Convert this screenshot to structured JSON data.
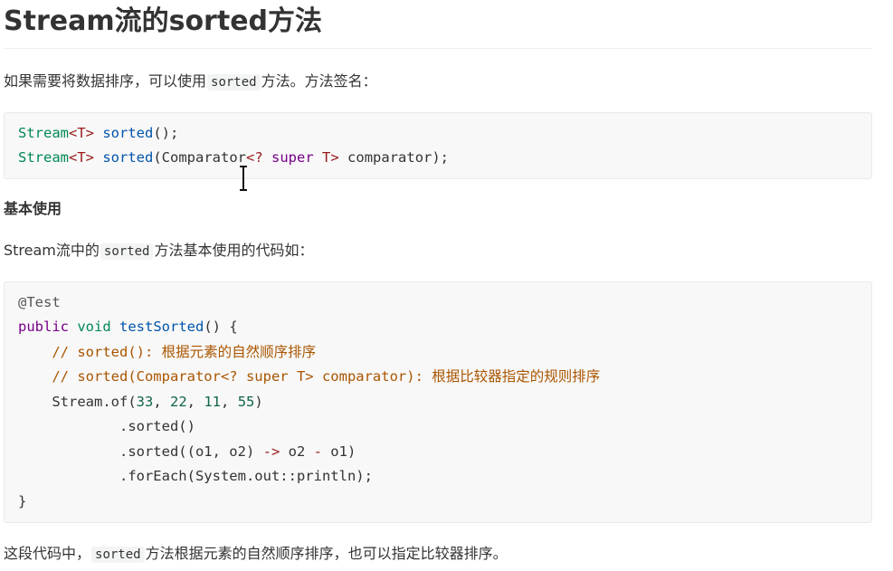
{
  "page": {
    "title": "Stream流的sorted方法",
    "intro": {
      "before": "如果需要将数据排序，可以使用",
      "code": "sorted",
      "after": "方法。方法签名："
    },
    "signatures": [
      [
        "Stream",
        "<T>",
        " ",
        "sorted",
        "();"
      ],
      [
        "Stream",
        "<T>",
        " ",
        "sorted",
        "(Comparator",
        "<?",
        " ",
        "super",
        " ",
        "T>",
        " comparator);"
      ]
    ],
    "subheading": "基本使用",
    "usage_intro": {
      "before": "Stream流中的",
      "code": "sorted",
      "after": "方法基本使用的代码如："
    },
    "example": {
      "annotation": "@Test",
      "kw_public": "public",
      "kw_void": "void",
      "method_name": "testSorted",
      "method_tail": "() {",
      "comment1": "// sorted(): 根据元素的自然顺序排序",
      "comment2": "// sorted(Comparator<? super T> comparator): 根据比较器指定的规则排序",
      "stream_of": "Stream.of(",
      "nums": [
        "33",
        "22",
        "11",
        "55"
      ],
      "sep": ", ",
      "close_paren": ")",
      "sorted_call": ".sorted()",
      "sorted_lambda_open": ".sorted((o1, o2) ",
      "arrow": "->",
      "lambda_body_a": " o2 ",
      "minus": "-",
      "lambda_body_b": " o1)",
      "foreach_call": ".forEach(System.out::println);",
      "closing_brace": "}"
    },
    "outro": {
      "before": "这段代码中，",
      "code": "sorted",
      "after": "方法根据元素的自然顺序排序，也可以指定比较器排序。"
    }
  },
  "theme": {
    "keyword": "#770088",
    "definition": "#0055aa",
    "variable_type": "#008855",
    "operator": "#981a1a",
    "number": "#116644",
    "comment": "#aa5500",
    "code_bg": "#f8f8f8"
  }
}
